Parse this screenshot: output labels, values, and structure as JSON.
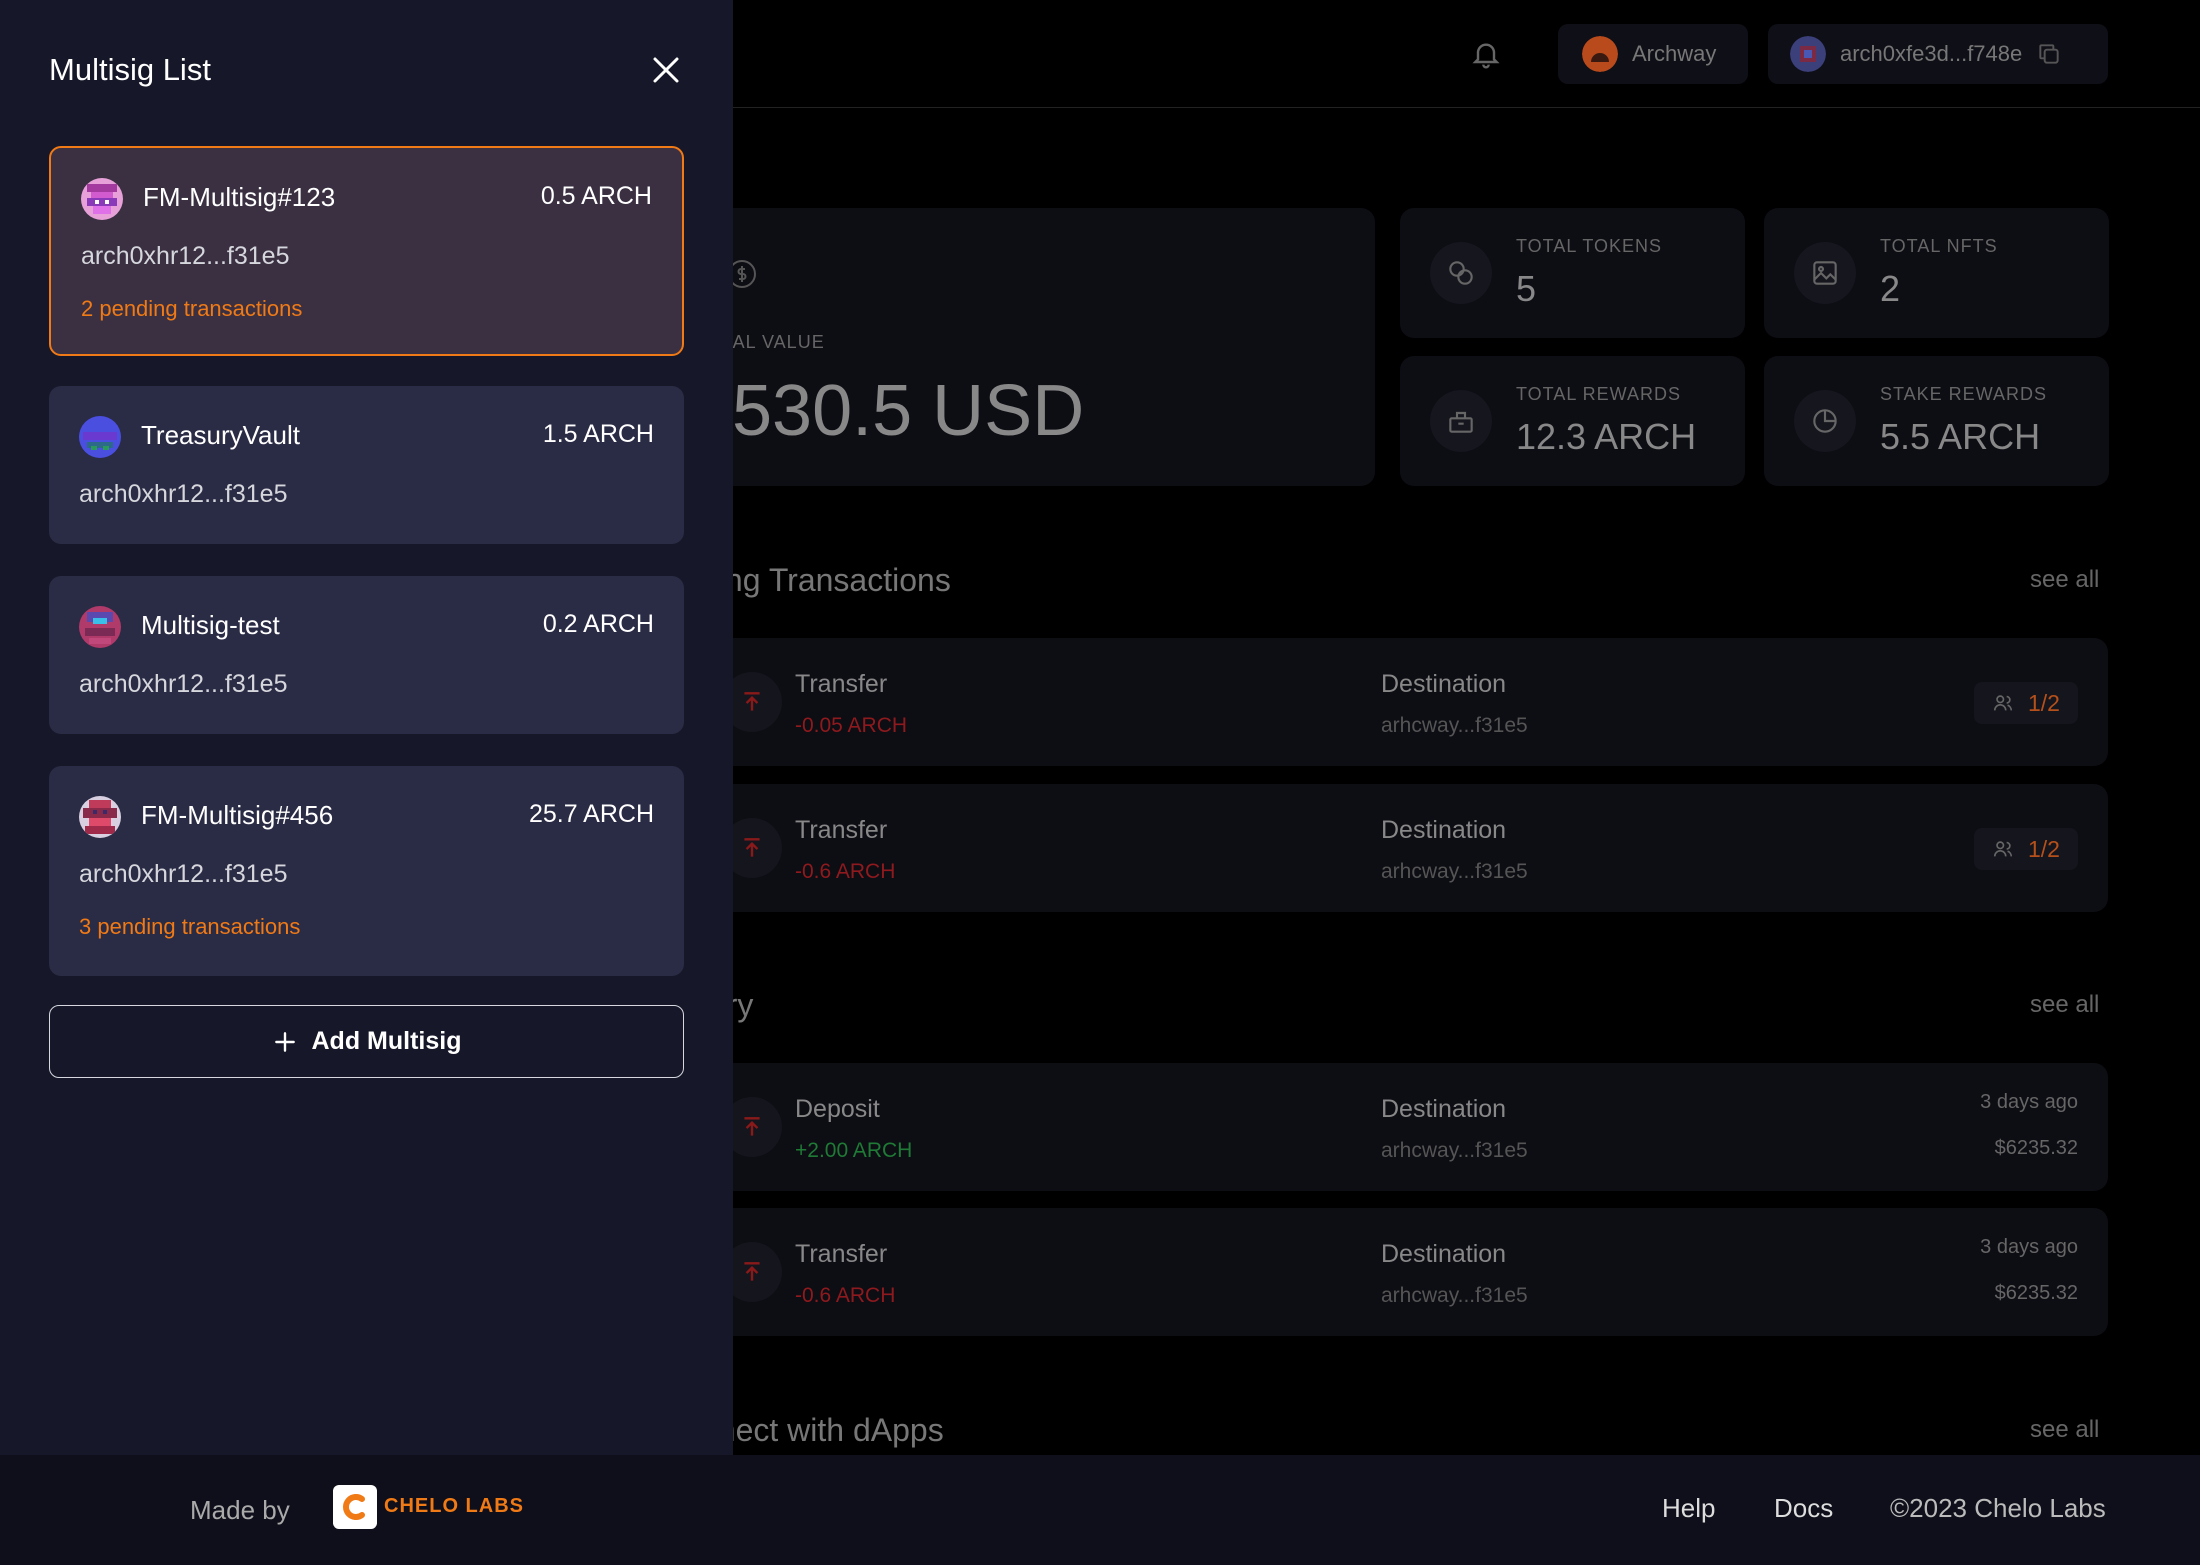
{
  "header": {
    "network": "Archway",
    "wallet": "arch0xfe3d...f748e"
  },
  "overview": {
    "total_value_label": "TAL VALUE",
    "total_value": "530.5 USD",
    "stats": [
      {
        "label": "TOTAL TOKENS",
        "value": "5",
        "icon": "coins-icon"
      },
      {
        "label": "TOTAL NFTS",
        "value": "2",
        "icon": "image-icon"
      },
      {
        "label": "TOTAL REWARDS",
        "value": "12.3 ARCH",
        "icon": "rewards-icon"
      },
      {
        "label": "STAKE REWARDS",
        "value": "5.5 ARCH",
        "icon": "pie-chart-icon"
      }
    ]
  },
  "pending": {
    "title": "ding Transactions",
    "see_all": "see all",
    "items": [
      {
        "kind": "Transfer",
        "amount": "-0.05 ARCH",
        "dest_label": "Destination",
        "dest": "arhcway...f31e5",
        "approvals": "1/2"
      },
      {
        "kind": "Transfer",
        "amount": "-0.6 ARCH",
        "dest_label": "Destination",
        "dest": "arhcway...f31e5",
        "approvals": "1/2"
      }
    ]
  },
  "history": {
    "title": "tory",
    "see_all": "see all",
    "items": [
      {
        "kind": "Deposit",
        "amount": "+2.00 ARCH",
        "dest_label": "Destination",
        "dest": "arhcway...f31e5",
        "ago": "3 days ago",
        "usd": "$6235.32"
      },
      {
        "kind": "Transfer",
        "amount": "-0.6 ARCH",
        "dest_label": "Destination",
        "dest": "arhcway...f31e5",
        "ago": "3 days ago",
        "usd": "$6235.32"
      }
    ]
  },
  "dapps": {
    "title": "nnect with dApps",
    "see_all": "see all"
  },
  "footer": {
    "made_by": "Made by",
    "brand": "CHELO LABS",
    "help": "Help",
    "docs": "Docs",
    "copyright": "©2023 Chelo Labs"
  },
  "drawer": {
    "title": "Multisig List",
    "add_label": "Add Multisig",
    "multisigs": [
      {
        "name": "FM-Multisig#123",
        "balance": "0.5 ARCH",
        "address": "arch0xhr12...f31e5",
        "pending": "2 pending transactions"
      },
      {
        "name": "TreasuryVault",
        "balance": "1.5 ARCH",
        "address": "arch0xhr12...f31e5",
        "pending": ""
      },
      {
        "name": "Multisig-test",
        "balance": "0.2 ARCH",
        "address": "arch0xhr12...f31e5",
        "pending": ""
      },
      {
        "name": "FM-Multisig#456",
        "balance": "25.7 ARCH",
        "address": "arch0xhr12...f31e5",
        "pending": "3 pending transactions"
      }
    ]
  },
  "colors": {
    "accent": "#f07a16",
    "negative": "#b0161c",
    "positive": "#1f8a3a",
    "drawer_bg": "#161728",
    "card_bg": "#2a2b45"
  }
}
